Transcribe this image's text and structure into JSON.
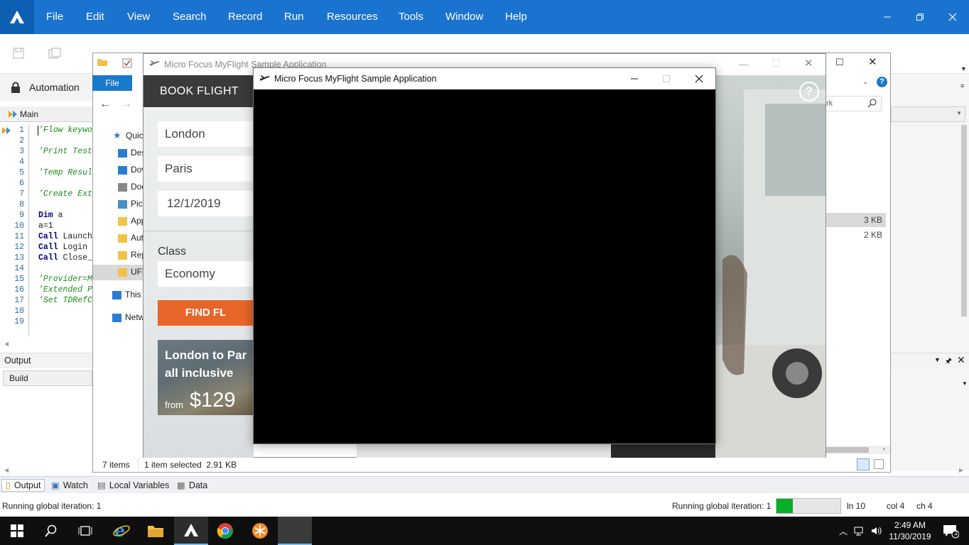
{
  "uft": {
    "menu": [
      "File",
      "Edit",
      "View",
      "Search",
      "Record",
      "Run",
      "Resources",
      "Tools",
      "Window",
      "Help"
    ],
    "automation_label": "Automation",
    "main_tab": "Main",
    "code_lines": [
      {
        "n": "1",
        "text": "'Flow keywo",
        "kind": "comment"
      },
      {
        "n": "2",
        "text": "",
        "kind": "plain"
      },
      {
        "n": "3",
        "text": "'Print Test",
        "kind": "comment"
      },
      {
        "n": "4",
        "text": "",
        "kind": "plain"
      },
      {
        "n": "5",
        "text": "'Temp Resul",
        "kind": "comment"
      },
      {
        "n": "6",
        "text": "",
        "kind": "plain"
      },
      {
        "n": "7",
        "text": "'Create Ext",
        "kind": "comment"
      },
      {
        "n": "8",
        "text": "",
        "kind": "plain"
      },
      {
        "n": "9",
        "kw": "Dim",
        "text": " a",
        "kind": "kw"
      },
      {
        "n": "10",
        "text": "a=1",
        "kind": "plain"
      },
      {
        "n": "11",
        "kw": "Call",
        "text": " Launch",
        "kind": "kw"
      },
      {
        "n": "12",
        "kw": "Call",
        "text": " Login",
        "kind": "kw"
      },
      {
        "n": "13",
        "kw": "Call",
        "text": " Close_",
        "kind": "kw"
      },
      {
        "n": "14",
        "text": "",
        "kind": "plain"
      },
      {
        "n": "15",
        "text": "'Provider=M",
        "kind": "comment"
      },
      {
        "n": "16",
        "text": "'Extended P",
        "kind": "comment"
      },
      {
        "n": "17",
        "text": "'Set TDRefC",
        "kind": "comment"
      },
      {
        "n": "18",
        "text": "",
        "kind": "plain"
      },
      {
        "n": "19",
        "text": "",
        "kind": "plain"
      }
    ],
    "output_label": "Output",
    "build_label": "Build",
    "bottom_tabs": [
      "Output",
      "Watch",
      "Local Variables",
      "Data"
    ],
    "status_left": "Running global iteration: 1",
    "status_right": "Running global iteration: 1",
    "progress": 0.26,
    "ln": "ln 10",
    "col": "col 4",
    "ch": "ch 4",
    "accent": "#1a73cf"
  },
  "explorer": {
    "file_tab": "File",
    "search_fragment": "rk",
    "nav": [
      "Quick",
      "Des",
      "Dov",
      "Doc",
      "Pict",
      "App",
      "Aut",
      "Rep",
      "UFT",
      "This I",
      "Netw"
    ],
    "sizes": [
      "3 KB",
      "2 KB"
    ],
    "items_count": "7 items",
    "selection": "1 item selected  2.91 KB"
  },
  "myflight_back": {
    "title": "Micro Focus MyFlight Sample Application",
    "header": "BOOK FLIGHT",
    "from": "London",
    "to": "Paris",
    "date": "12/1/2019",
    "class_label": "Class",
    "class_value": "Economy",
    "find_button": "FIND FL",
    "promo_line1": "London to Par",
    "promo_line2": "all inclusive",
    "promo_from": "from",
    "promo_price": "$129",
    "help": "?"
  },
  "myflight_front": {
    "title": "Micro Focus MyFlight Sample Application"
  },
  "taskbar": {
    "time": "2:49 AM",
    "date": "11/30/2019",
    "notifications": "1"
  }
}
